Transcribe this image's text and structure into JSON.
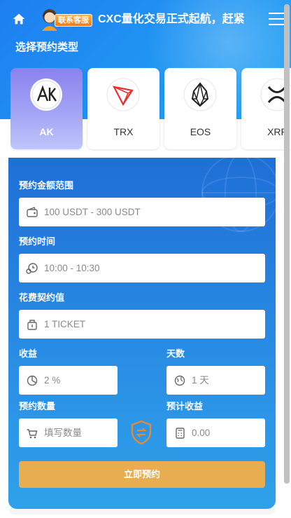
{
  "header": {
    "customer_service_label": "联系客服",
    "marquee_text": "CXC量化交易正式起航，赶紧"
  },
  "reservation": {
    "section_title": "选择预约类型",
    "types": [
      {
        "label": "AK",
        "active": true
      },
      {
        "label": "TRX",
        "active": false
      },
      {
        "label": "EOS",
        "active": false
      },
      {
        "label": "XRP",
        "active": false
      }
    ]
  },
  "form": {
    "amount_label": "预约金额范围",
    "amount_value": "100 USDT - 300 USDT",
    "time_label": "预约时间",
    "time_value": "10:00 - 10:30",
    "contract_label": "花费契约值",
    "contract_value": "1 TICKET",
    "yield_label": "收益",
    "yield_value": "2 %",
    "days_label": "天数",
    "days_value": "1 天",
    "quantity_label": "预约数量",
    "quantity_placeholder": "填写数量",
    "expected_label": "预计收益",
    "expected_value": "0.00",
    "submit_label": "立即预约"
  },
  "colors": {
    "header_blue": "#2196f3",
    "panel_blue": "#1f6fd6",
    "submit_orange": "#e8ad4f",
    "active_card": "#8a82ee",
    "badge_orange": "#f07a1a"
  },
  "icons": [
    "home-icon",
    "customer-service-avatar",
    "menu-icon",
    "wallet-icon",
    "clock-icon",
    "ticket-icon",
    "chart-icon",
    "globe-icon",
    "cart-icon",
    "swap-shield-icon",
    "calculator-icon"
  ]
}
